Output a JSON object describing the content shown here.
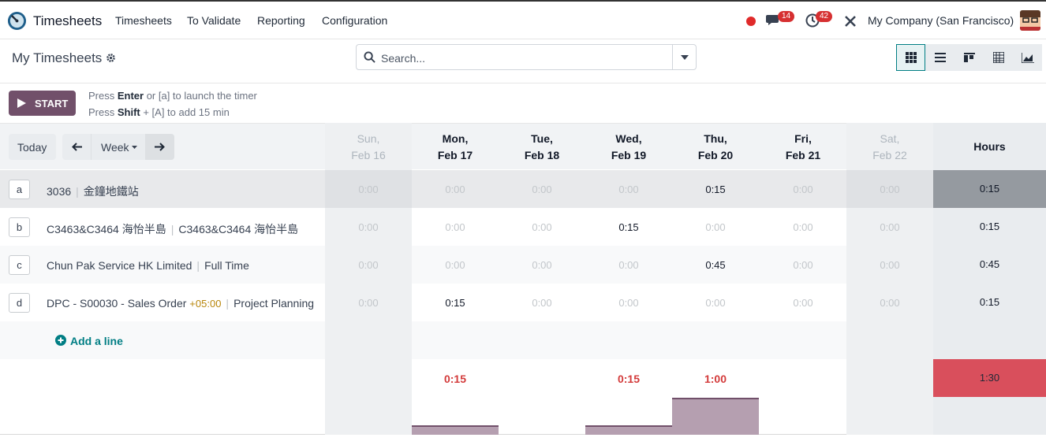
{
  "topbar": {
    "app_name": "Timesheets",
    "menu": [
      "Timesheets",
      "To Validate",
      "Reporting",
      "Configuration"
    ],
    "messages_count": "14",
    "activities_count": "42",
    "company": "My Company (San Francisco)",
    "colors": {
      "brand": "#71506a",
      "badge": "#d63031",
      "status_dot": "#e02a2a"
    }
  },
  "control_panel": {
    "title": "My Timesheets",
    "search_placeholder": "Search...",
    "views": [
      "grid-icon",
      "list-icon",
      "kanban-icon",
      "pivot-icon",
      "graph-icon"
    ],
    "active_view": "grid-icon"
  },
  "timer": {
    "start_label": "START",
    "hint1_a": "Press ",
    "hint1_b": "Enter",
    "hint1_c": " or [a] to launch the timer",
    "hint2_a": "Press ",
    "hint2_b": "Shift",
    "hint2_c": " + [A] to add 15 min"
  },
  "grid": {
    "today": "Today",
    "range": "Week",
    "days": [
      {
        "dow": "Sun,",
        "date": "Feb 16",
        "weekend": true
      },
      {
        "dow": "Mon,",
        "date": "Feb 17",
        "weekend": false
      },
      {
        "dow": "Tue,",
        "date": "Feb 18",
        "weekend": false
      },
      {
        "dow": "Wed,",
        "date": "Feb 19",
        "weekend": false
      },
      {
        "dow": "Thu,",
        "date": "Feb 20",
        "weekend": false
      },
      {
        "dow": "Fri,",
        "date": "Feb 21",
        "weekend": false
      },
      {
        "dow": "Sat,",
        "date": "Feb 22",
        "weekend": true
      }
    ],
    "hours_header": "Hours",
    "rows": [
      {
        "key": "a",
        "project": "3036",
        "task": "金鐘地鐵站",
        "extra": "",
        "cells": [
          "0:00",
          "0:00",
          "0:00",
          "0:00",
          "0:15",
          "0:00",
          "0:00"
        ],
        "total": "0:15"
      },
      {
        "key": "b",
        "project": "C3463&C3464 海怡半島",
        "task": "C3463&C3464 海怡半島",
        "extra": "",
        "cells": [
          "0:00",
          "0:00",
          "0:00",
          "0:15",
          "0:00",
          "0:00",
          "0:00"
        ],
        "total": "0:15"
      },
      {
        "key": "c",
        "project": "Chun Pak Service HK Limited",
        "task": "Full Time",
        "extra": "",
        "cells": [
          "0:00",
          "0:00",
          "0:00",
          "0:00",
          "0:45",
          "0:00",
          "0:00"
        ],
        "total": "0:45"
      },
      {
        "key": "d",
        "project": "DPC - S00030 - Sales Order",
        "task": "Project Planning",
        "extra": "+05:00",
        "cells": [
          "0:00",
          "0:15",
          "0:00",
          "0:00",
          "0:00",
          "0:00",
          "0:00"
        ],
        "total": "0:15"
      }
    ],
    "add_line": "Add a line",
    "daily_totals": [
      "",
      "0:15",
      "",
      "0:15",
      "1:00",
      "",
      ""
    ],
    "grand_total": "1:30",
    "bar_levels": [
      0,
      0.25,
      0,
      0.25,
      1,
      0,
      0
    ]
  }
}
